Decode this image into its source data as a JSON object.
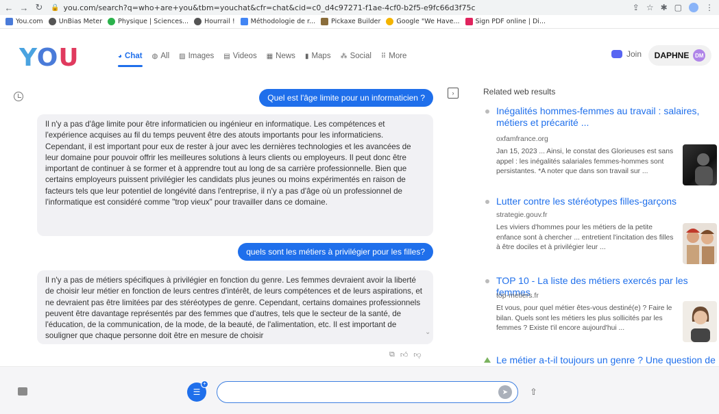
{
  "browser": {
    "url": "you.com/search?q=who+are+you&tbm=youchat&cfr=chat&cid=c0_d4c97271-f1ae-4cf0-b2f5-e9fc66d3f75c"
  },
  "bookmarks": [
    {
      "label": "You.com",
      "color": "#4a7bd9"
    },
    {
      "label": "UnBias Meter",
      "color": "#555555"
    },
    {
      "label": "Physique | Sciences...",
      "color": "#2bb24c"
    },
    {
      "label": "Hourrail !",
      "color": "#555555"
    },
    {
      "label": "Méthodologie de r...",
      "color": "#4285f4"
    },
    {
      "label": "Pickaxe Builder",
      "color": "#8a6d3b"
    },
    {
      "label": "Google \"We Have...",
      "color": "#f4b400"
    },
    {
      "label": "Sign PDF online | Di...",
      "color": "#e0245e"
    }
  ],
  "nav": {
    "tabs": [
      {
        "label": "Chat",
        "icon": "chat-icon",
        "active": true
      },
      {
        "label": "All",
        "icon": "globe-icon"
      },
      {
        "label": "Images",
        "icon": "image-icon"
      },
      {
        "label": "Videos",
        "icon": "video-icon"
      },
      {
        "label": "News",
        "icon": "news-icon"
      },
      {
        "label": "Maps",
        "icon": "map-icon"
      },
      {
        "label": "Social",
        "icon": "social-icon"
      },
      {
        "label": "More",
        "icon": "grid-icon"
      }
    ],
    "join_label": "Join",
    "user_name": "DAPHNE",
    "user_initials": "DM"
  },
  "chat": {
    "user_msg_1": "Quel est l'âge limite pour un informaticien ?",
    "bot_msg_1": "Il n'y a pas d'âge limite pour être informaticien ou ingénieur en informatique. Les compétences et l'expérience acquises au fil du temps peuvent être des atouts importants pour les informaticiens. Cependant, il est important pour eux de rester à jour avec les dernières technologies et les avancées de leur domaine pour pouvoir offrir les meilleures solutions à leurs clients ou employeurs. Il peut donc être important de continuer à se former et à apprendre tout au long de sa carrière professionnelle. Bien que certains employeurs puissent privilégier les candidats plus jeunes ou moins expérimentés en raison de facteurs tels que leur potentiel de longévité dans l'entreprise, il n'y a pas d'âge où un professionnel de l'informatique est considéré comme \"trop vieux\" pour travailler dans ce domaine.",
    "user_msg_2": "quels sont les métiers à privilégier pour les filles?",
    "bot_msg_2": "Il n'y a pas de métiers spécifiques à privilégier en fonction du genre. Les femmes devraient avoir la liberté de choisir leur métier en fonction de leurs centres d'intérêt, de leurs compétences et de leurs aspirations, et ne devraient pas être limitées par des stéréotypes de genre. Cependant, certains domaines professionnels peuvent être davantage représentés par des femmes que d'autres, tels que le secteur de la santé, de l'éducation, de la communication, de la mode, de la beauté, de l'alimentation, etc. Il est important de souligner que chaque personne doit être en mesure de choisir"
  },
  "results": {
    "title": "Related web results",
    "items": [
      {
        "title": "Inégalités hommes-femmes au travail : salaires, métiers et précarité ...",
        "source": "oxfamfrance.org",
        "snippet": "Jan 15, 2023 ... Ainsi, le constat des Glorieuses est sans appel : les inégalités salariales femmes-hommes sont persistantes. *A noter que dans son travail sur ..."
      },
      {
        "title": "Lutter contre les stéréotypes filles-garçons",
        "source": "strategie.gouv.fr",
        "snippet": "Les viviers d'hommes pour les métiers de la petite enfance sont à chercher ... entretient l'incitation des filles à être dociles et à privilégier leur ..."
      },
      {
        "title": "TOP 10 - La liste des métiers exercés par les femmes",
        "source": "top-metiers.fr",
        "snippet": "Et vous, pour quel métier êtes-vous destiné(e) ? Faire le bilan. Quels sont les métiers les plus sollicités par les femmes ? Existe t'il encore aujourd'hui ..."
      },
      {
        "title": "Le métier a-t-il toujours un genre ? Une question de"
      }
    ]
  },
  "colors": {
    "accent": "#1f6feb",
    "bot_bubble": "#f1f1f4"
  }
}
